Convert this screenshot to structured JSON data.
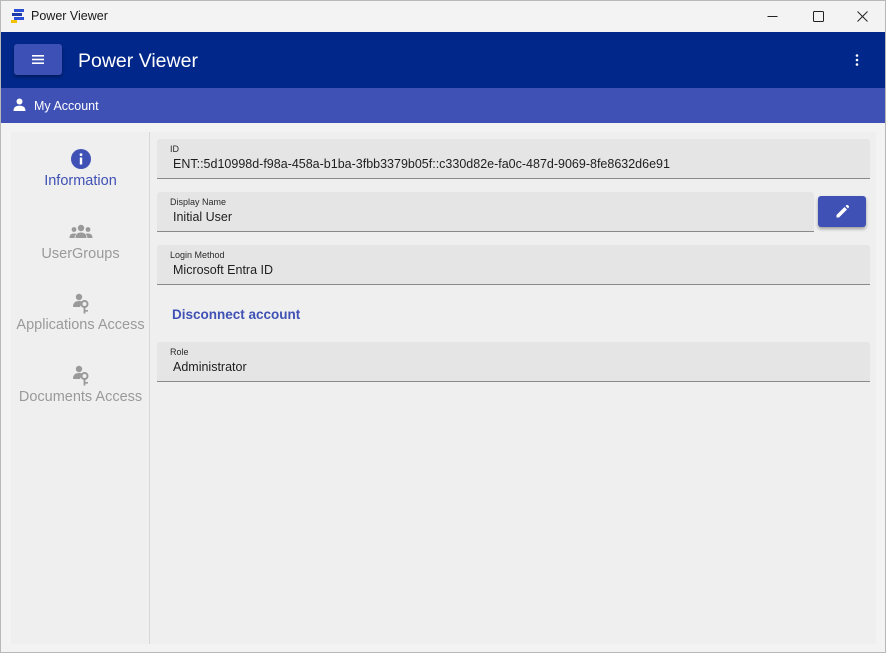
{
  "window": {
    "title": "Power Viewer",
    "controls": {
      "minimize": "—",
      "maximize": "☐",
      "close": "✕"
    }
  },
  "appbar": {
    "title": "Power Viewer",
    "menu_icon": "hamburger-icon",
    "more_icon": "kebab-menu-icon"
  },
  "breadcrumb": {
    "label": "My Account",
    "icon": "person-icon"
  },
  "nav": {
    "items": [
      {
        "label": "Information",
        "icon": "info-icon",
        "active": true
      },
      {
        "label": "UserGroups",
        "icon": "user-groups-icon",
        "active": false
      },
      {
        "label": "Applications Access",
        "icon": "access-icon",
        "active": false
      },
      {
        "label": "Documents Access",
        "icon": "access-icon",
        "active": false
      }
    ]
  },
  "fields": {
    "id": {
      "label": "ID",
      "value": "ENT::5d10998d-f98a-458a-b1ba-3fbb3379b05f::c330d82e-fa0c-487d-9069-8fe8632d6e91"
    },
    "display_name": {
      "label": "Display Name",
      "value": "Initial User"
    },
    "login_method": {
      "label": "Login Method",
      "value": "Microsoft Entra ID"
    },
    "role": {
      "label": "Role",
      "value": "Administrator"
    }
  },
  "actions": {
    "disconnect_label": "Disconnect account",
    "edit_icon": "pencil-icon"
  },
  "colors": {
    "appbar": "#01278a",
    "breadcrumb_bar": "#3f51b5",
    "accent": "#3f51b5",
    "inactive_nav": "#9a9a9a"
  }
}
